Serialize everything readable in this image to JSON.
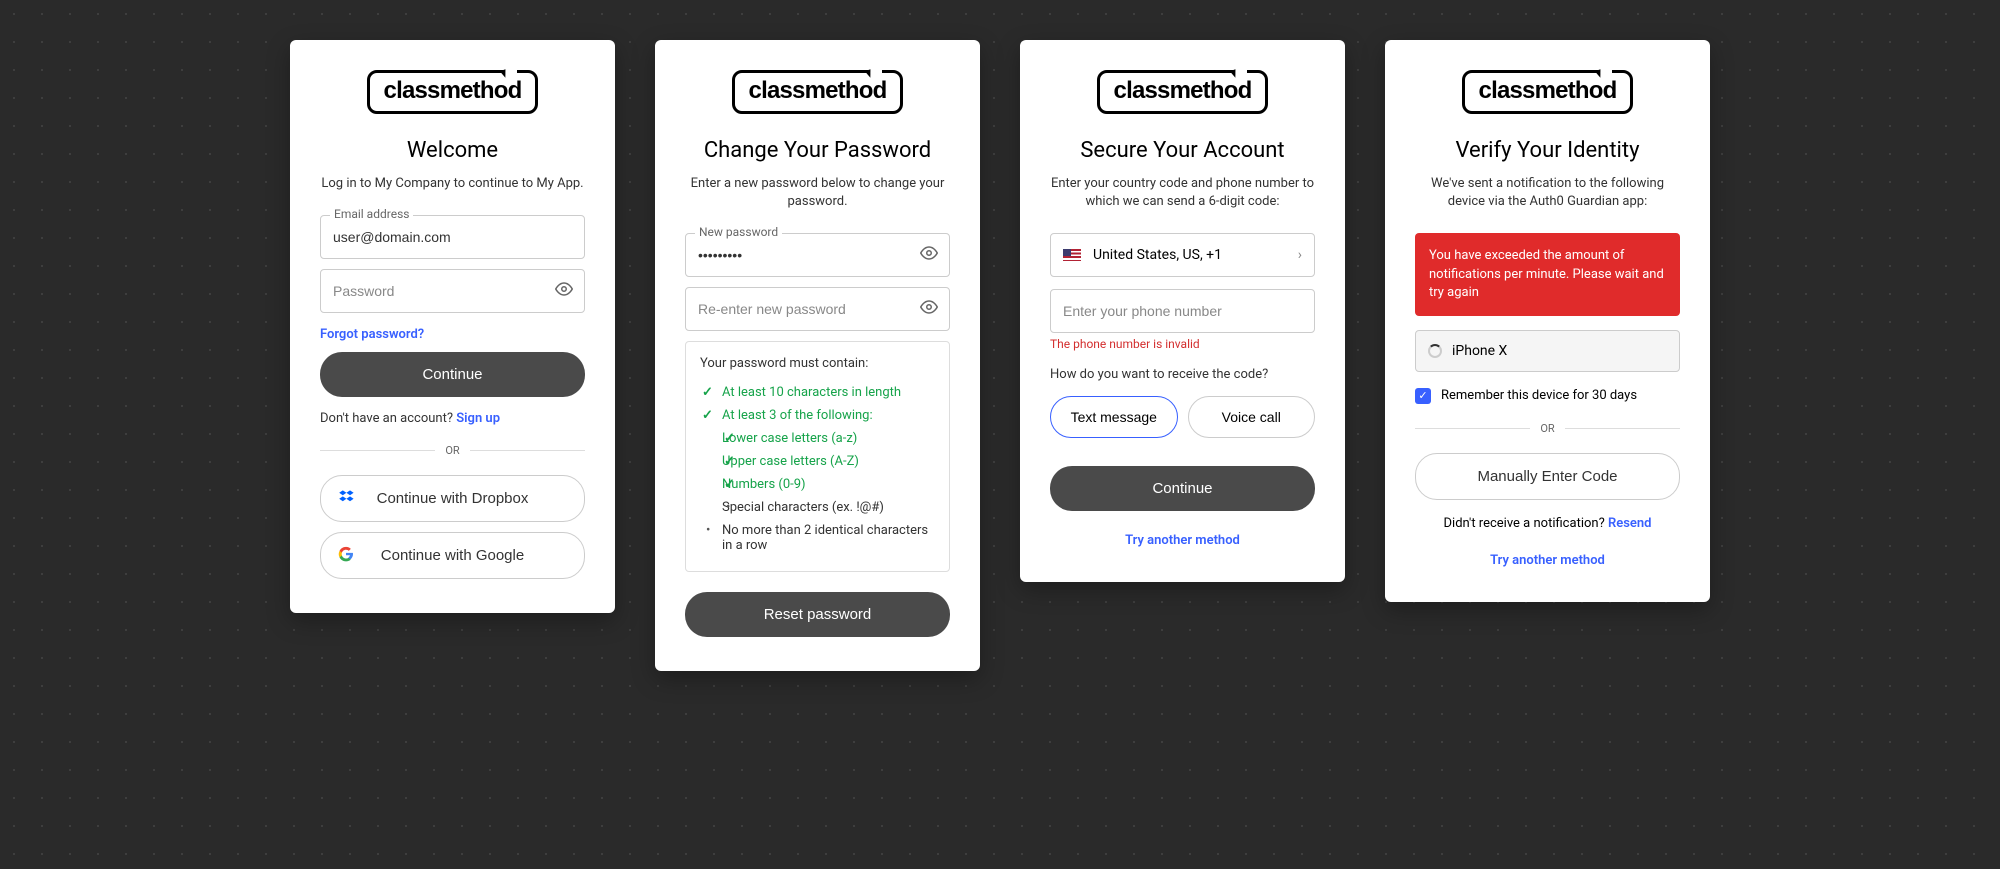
{
  "brand": "classmethod",
  "login": {
    "title": "Welcome",
    "subtitle": "Log in to My Company to continue to My App.",
    "email_label": "Email address",
    "email_value": "user@domain.com",
    "password_placeholder": "Password",
    "forgot": "Forgot password?",
    "continue": "Continue",
    "noaccount": "Don't have an account?",
    "signup": "Sign up",
    "or": "OR",
    "dropbox": "Continue with Dropbox",
    "google": "Continue with Google"
  },
  "change_pw": {
    "title": "Change Your Password",
    "subtitle": "Enter a new password below to change your password.",
    "new_label": "New password",
    "new_value": "•••••••••",
    "reenter_placeholder": "Re-enter new password",
    "rules_title": "Your password must contain:",
    "rule1": "At least 10 characters in length",
    "rule2": "At least 3 of the following:",
    "rule2a": "Lower case letters (a-z)",
    "rule2b": "Upper case letters (A-Z)",
    "rule2c": "Numbers (0-9)",
    "rule2d": "Special characters (ex. !@#)",
    "rule3": "No more than 2 identical characters in a row",
    "reset_btn": "Reset password"
  },
  "secure": {
    "title": "Secure Your Account",
    "subtitle": "Enter your country code and phone number to which we can send a 6-digit code:",
    "country": "United States, US, +1",
    "phone_placeholder": "Enter your phone number",
    "error": "The phone number is invalid",
    "question": "How do you want to receive the code?",
    "sms": "Text message",
    "voice": "Voice call",
    "continue": "Continue",
    "try_another": "Try another method"
  },
  "verify": {
    "title": "Verify Your Identity",
    "subtitle": "We've sent a notification to the following device via the Auth0 Guardian app:",
    "error": "You have exceeded the amount of notifications per minute. Please wait and try again",
    "device": "iPhone X",
    "remember": "Remember this device for 30 days",
    "or": "OR",
    "manual": "Manually Enter Code",
    "didnt_receive": "Didn't receive a notification?",
    "resend": "Resend",
    "try_another": "Try another method"
  }
}
